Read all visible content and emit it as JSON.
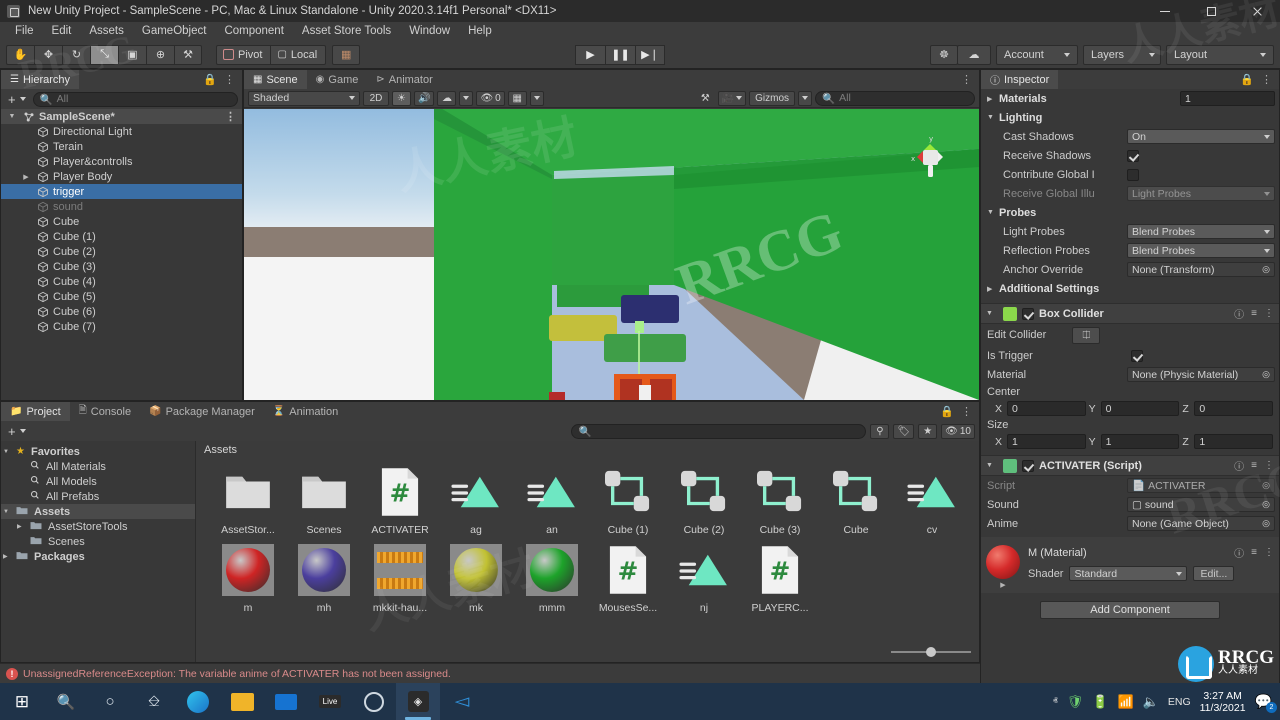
{
  "window": {
    "title": "New Unity Project - SampleScene - PC, Mac & Linux Standalone - Unity 2020.3.14f1 Personal* <DX11>",
    "minimize": "–",
    "maximize": "□",
    "close": "✕"
  },
  "menu": {
    "items": [
      "File",
      "Edit",
      "Assets",
      "GameObject",
      "Component",
      "Asset Store Tools",
      "Window",
      "Help"
    ]
  },
  "toolbar": {
    "tools": [
      {
        "name": "hand-tool",
        "glyph": "✋"
      },
      {
        "name": "move-tool",
        "glyph": "✥"
      },
      {
        "name": "rotate-tool",
        "glyph": "↻"
      },
      {
        "name": "scale-tool",
        "glyph": "⤡"
      },
      {
        "name": "rect-tool",
        "glyph": "▣"
      },
      {
        "name": "transform-tool",
        "glyph": "⊕"
      },
      {
        "name": "custom-tool",
        "glyph": "⚒"
      }
    ],
    "pivot_label": "Pivot",
    "local_label": "Local",
    "grid_glyph": "▦",
    "play": "▶",
    "pause": "❚❚",
    "step": "▶❘",
    "collab_glyph": "☸",
    "cloud_glyph": "☁",
    "account_label": "Account",
    "layers_label": "Layers",
    "layout_label": "Layout"
  },
  "hierarchy": {
    "tab": "Hierarchy",
    "add_label": "+",
    "search_placeholder": "All",
    "items": [
      {
        "label": "SampleScene*",
        "depth": 0,
        "type": "scene",
        "state": "normal",
        "expanded": true
      },
      {
        "label": "Directional Light",
        "depth": 1,
        "type": "gameobject",
        "state": "normal"
      },
      {
        "label": "Terain",
        "depth": 1,
        "type": "gameobject",
        "state": "normal"
      },
      {
        "label": "Player&controlls",
        "depth": 1,
        "type": "gameobject",
        "state": "normal"
      },
      {
        "label": "Player Body",
        "depth": 1,
        "type": "gameobject",
        "state": "normal",
        "expandable": true
      },
      {
        "label": "trigger",
        "depth": 1,
        "type": "gameobject",
        "state": "selected"
      },
      {
        "label": "sound",
        "depth": 1,
        "type": "gameobject",
        "state": "disabled"
      },
      {
        "label": "Cube",
        "depth": 1,
        "type": "gameobject",
        "state": "normal"
      },
      {
        "label": "Cube (1)",
        "depth": 1,
        "type": "gameobject",
        "state": "normal"
      },
      {
        "label": "Cube (2)",
        "depth": 1,
        "type": "gameobject",
        "state": "normal"
      },
      {
        "label": "Cube (3)",
        "depth": 1,
        "type": "gameobject",
        "state": "normal"
      },
      {
        "label": "Cube (4)",
        "depth": 1,
        "type": "gameobject",
        "state": "normal"
      },
      {
        "label": "Cube (5)",
        "depth": 1,
        "type": "gameobject",
        "state": "normal"
      },
      {
        "label": "Cube (6)",
        "depth": 1,
        "type": "gameobject",
        "state": "normal"
      },
      {
        "label": "Cube (7)",
        "depth": 1,
        "type": "gameobject",
        "state": "normal"
      }
    ]
  },
  "scene": {
    "tabs": [
      {
        "label": "Scene",
        "active": true,
        "icon": "grid-icon"
      },
      {
        "label": "Game",
        "active": false,
        "icon": "gamepad-icon"
      },
      {
        "label": "Animator",
        "active": false,
        "icon": "animator-icon"
      }
    ],
    "shading_mode": "Shaded",
    "mode_2d": "2D",
    "light_glyph": "☀",
    "audio_glyph": "🔊",
    "fx_glyph": "☁",
    "hidden_count": "0",
    "grid_glyph": "▦",
    "tools_glyph": "⚒",
    "camera_glyph": "▶",
    "gizmos_label": "Gizmos",
    "search_placeholder": "All",
    "gizmo_axes": {
      "x": "x",
      "y": "y",
      "z": "z"
    },
    "colors": {
      "sky_top": "#9dc4e4",
      "sky_horizon": "#dfe9f1",
      "ground": "#8b7d74",
      "wall_green": "#2aa73e",
      "wall_green_dark": "#1f8f33",
      "floor_blue": "#a8bede",
      "block_navy": "#2d2f72",
      "block_yellow": "#c5c03d",
      "block_green": "#3f9f46",
      "object_orange": "#e05b18",
      "platform_white": "#f2f2f2"
    }
  },
  "inspector": {
    "tab": "Inspector",
    "renderer": {
      "materials_label": "Materials",
      "materials_count": "1",
      "lighting_label": "Lighting",
      "cast_shadows_label": "Cast Shadows",
      "cast_shadows_value": "On",
      "receive_shadows_label": "Receive Shadows",
      "receive_shadows_checked": true,
      "contribute_gi_label": "Contribute Global I",
      "contribute_gi_checked": false,
      "receive_gi_label": "Receive Global Illu",
      "receive_gi_value": "Light Probes",
      "probes_label": "Probes",
      "light_probes_label": "Light Probes",
      "light_probes_value": "Blend Probes",
      "reflection_probes_label": "Reflection Probes",
      "reflection_probes_value": "Blend Probes",
      "anchor_override_label": "Anchor Override",
      "anchor_override_value": "None (Transform)",
      "additional_settings_label": "Additional Settings"
    },
    "box_collider": {
      "title": "Box Collider",
      "enabled": true,
      "edit_collider_label": "Edit Collider",
      "is_trigger_label": "Is Trigger",
      "is_trigger_checked": true,
      "material_label": "Material",
      "material_value": "None (Physic Material)",
      "center_label": "Center",
      "center": {
        "x": "0",
        "y": "0",
        "z": "0"
      },
      "size_label": "Size",
      "size": {
        "x": "1",
        "y": "1",
        "z": "1"
      },
      "axis_x": "X",
      "axis_y": "Y",
      "axis_z": "Z"
    },
    "script_component": {
      "title": "ACTIVATER (Script)",
      "enabled": true,
      "script_label": "Script",
      "script_value": "ACTIVATER",
      "sound_label": "Sound",
      "sound_value": "sound",
      "anime_label": "Anime",
      "anime_value": "None (Game Object)"
    },
    "material": {
      "title": "M (Material)",
      "shader_label": "Shader",
      "shader_value": "Standard",
      "edit_label": "Edit...",
      "preview_color": "#cf2c2c"
    },
    "add_component_label": "Add Component"
  },
  "project": {
    "tabs": [
      {
        "label": "Project",
        "active": true,
        "icon": "folder-icon"
      },
      {
        "label": "Console",
        "active": false,
        "icon": "console-icon"
      },
      {
        "label": "Package Manager",
        "active": false,
        "icon": "package-icon"
      },
      {
        "label": "Animation",
        "active": false,
        "icon": "animation-icon"
      }
    ],
    "add_label": "+",
    "search_placeholder": "",
    "filter_count": "10",
    "breadcrumb": "Assets",
    "tree": [
      {
        "label": "Favorites",
        "depth": 0,
        "icon": "star-icon",
        "expanded": true
      },
      {
        "label": "All Materials",
        "depth": 1,
        "icon": "search-icon"
      },
      {
        "label": "All Models",
        "depth": 1,
        "icon": "search-icon"
      },
      {
        "label": "All Prefabs",
        "depth": 1,
        "icon": "search-icon"
      },
      {
        "label": "Assets",
        "depth": 0,
        "icon": "folder-icon",
        "expanded": true,
        "selected": true
      },
      {
        "label": "AssetStoreTools",
        "depth": 1,
        "icon": "folder-icon",
        "expandable": true
      },
      {
        "label": "Scenes",
        "depth": 1,
        "icon": "folder-icon"
      },
      {
        "label": "Packages",
        "depth": 0,
        "icon": "folder-icon",
        "expandable": true
      }
    ],
    "assets": [
      {
        "label": "AssetStor...",
        "type": "folder"
      },
      {
        "label": "Scenes",
        "type": "folder"
      },
      {
        "label": "ACTIVATER",
        "type": "script"
      },
      {
        "label": "ag",
        "type": "animation"
      },
      {
        "label": "an",
        "type": "animation"
      },
      {
        "label": "Cube (1)",
        "type": "prefab"
      },
      {
        "label": "Cube (2)",
        "type": "prefab"
      },
      {
        "label": "Cube (3)",
        "type": "prefab"
      },
      {
        "label": "Cube",
        "type": "prefab"
      },
      {
        "label": "cv",
        "type": "animation"
      },
      {
        "label": "m",
        "type": "material",
        "color": "#cf2424"
      },
      {
        "label": "mh",
        "type": "material",
        "color": "#4b3f9e"
      },
      {
        "label": "mkkit-hau...",
        "type": "texture"
      },
      {
        "label": "mk",
        "type": "material",
        "color": "#c2c233"
      },
      {
        "label": "mmm",
        "type": "material",
        "color": "#1da32a"
      },
      {
        "label": "MousesSe...",
        "type": "script"
      },
      {
        "label": "nj",
        "type": "animation"
      },
      {
        "label": "PLAYERC...",
        "type": "script"
      }
    ]
  },
  "status": {
    "error_icon": "!",
    "error_text": "UnassignedReferenceException: The variable anime of ACTIVATER has not been assigned."
  },
  "taskbar": {
    "items": [
      {
        "name": "start-button",
        "glyph": "⊞"
      },
      {
        "name": "search-icon",
        "glyph": "⚲"
      },
      {
        "name": "cortana-icon",
        "glyph": "○"
      },
      {
        "name": "task-view-icon",
        "glyph": "❑"
      },
      {
        "name": "edge-icon",
        "glyph": "e"
      },
      {
        "name": "file-explorer-icon",
        "glyph": "🗀"
      },
      {
        "name": "mail-icon",
        "glyph": "✉"
      },
      {
        "name": "live-icon",
        "glyph": "Live"
      },
      {
        "name": "obs-icon",
        "glyph": "◉"
      },
      {
        "name": "unity-icon",
        "glyph": "⬟",
        "active": true
      },
      {
        "name": "vscode-icon",
        "glyph": "◁"
      }
    ],
    "tray": {
      "chevron": "ⱏ",
      "language": "ENG",
      "time": "3:27 AM",
      "date": "11/3/2021",
      "notification_count": "2"
    }
  },
  "watermarks": {
    "rrcg": "RRCG",
    "chinese": "人人素材"
  }
}
